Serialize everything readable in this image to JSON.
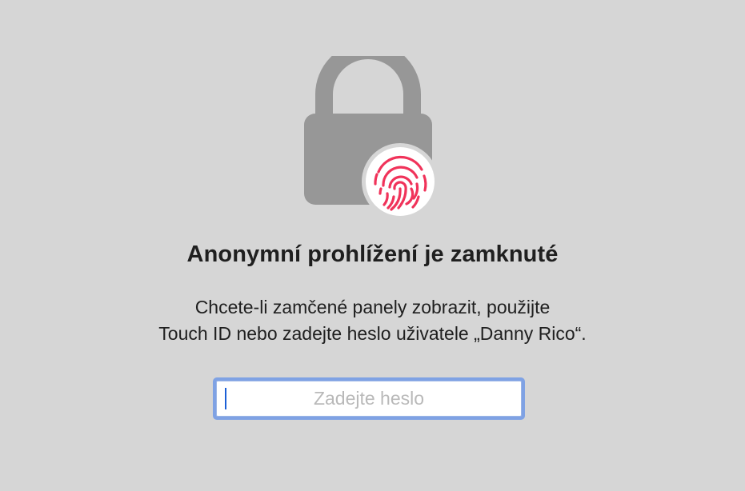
{
  "lock_screen": {
    "title": "Anonymní prohlížení je zamknuté",
    "message_line_1": "Chcete-li zamčené panely zobrazit, použijte",
    "message_line_2": "Touch ID nebo zadejte heslo uživatele „Danny Rico“.",
    "password_placeholder": "Zadejte heslo",
    "password_value": ""
  },
  "icons": {
    "lock": "padlock-icon",
    "fingerprint": "touch-id-fingerprint-icon"
  },
  "colors": {
    "background": "#d6d6d6",
    "lock_gray": "#979797",
    "fingerprint_red": "#f0335a",
    "focus_ring": "#7fa2e4",
    "caret_blue": "#1b5fd6"
  }
}
